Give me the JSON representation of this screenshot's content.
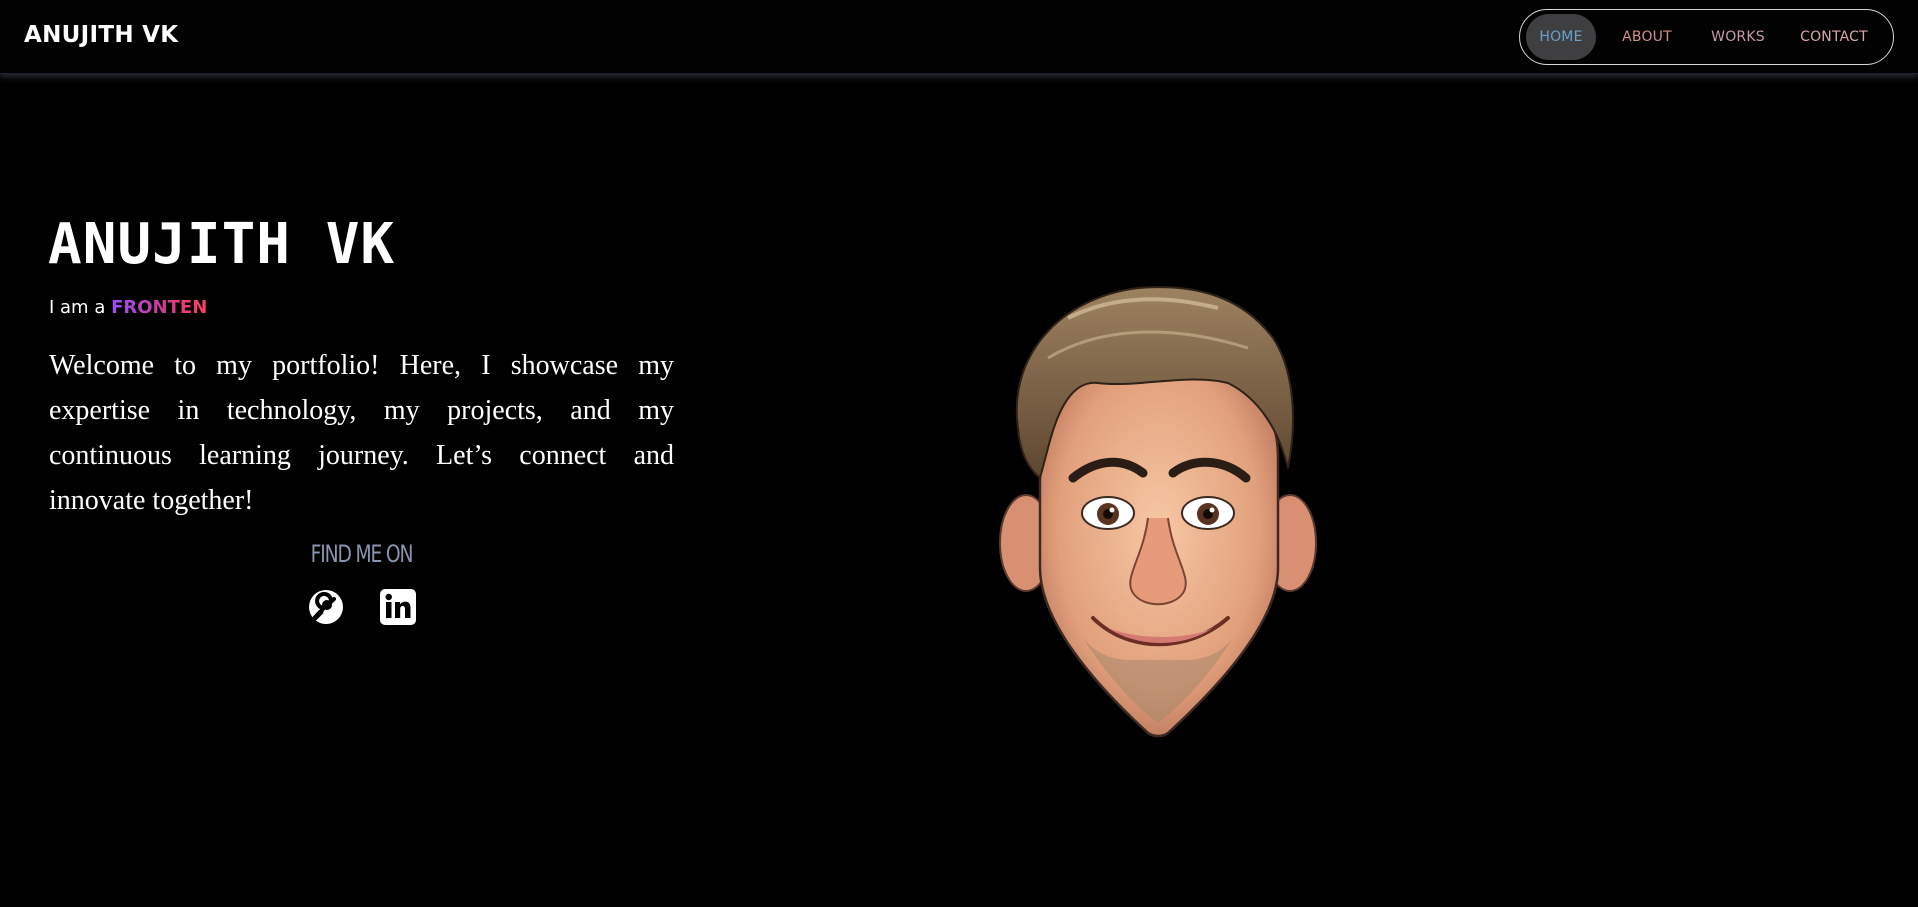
{
  "header": {
    "brand": "ANUJITH VK",
    "nav": [
      {
        "label": "HOME",
        "active": true
      },
      {
        "label": "ABOUT",
        "active": false
      },
      {
        "label": "WORKS",
        "active": false
      },
      {
        "label": "CONTACT",
        "active": false
      }
    ]
  },
  "hero": {
    "name": "ANUJITH VK",
    "role_prefix": "I am a",
    "role_typed": "FRONTEN",
    "intro": "Welcome to my portfolio! Here, I showcase my expertise in technology, my projects, and my continuous learning journey. Let’s connect and innovate together!",
    "find_me_label": "FIND ME ON"
  },
  "socials": [
    {
      "icon": "instagram-icon"
    },
    {
      "icon": "linkedin-icon"
    }
  ],
  "avatar": {
    "icon": "cartoon-avatar-illustration"
  },
  "colors": {
    "background": "#000000",
    "nav_active_bg": "#3f3f42",
    "nav_border": "#d6d6d6",
    "gradient_start": "#9b4dff",
    "gradient_end": "#ff3f5f",
    "find_me": "#8796b0"
  }
}
